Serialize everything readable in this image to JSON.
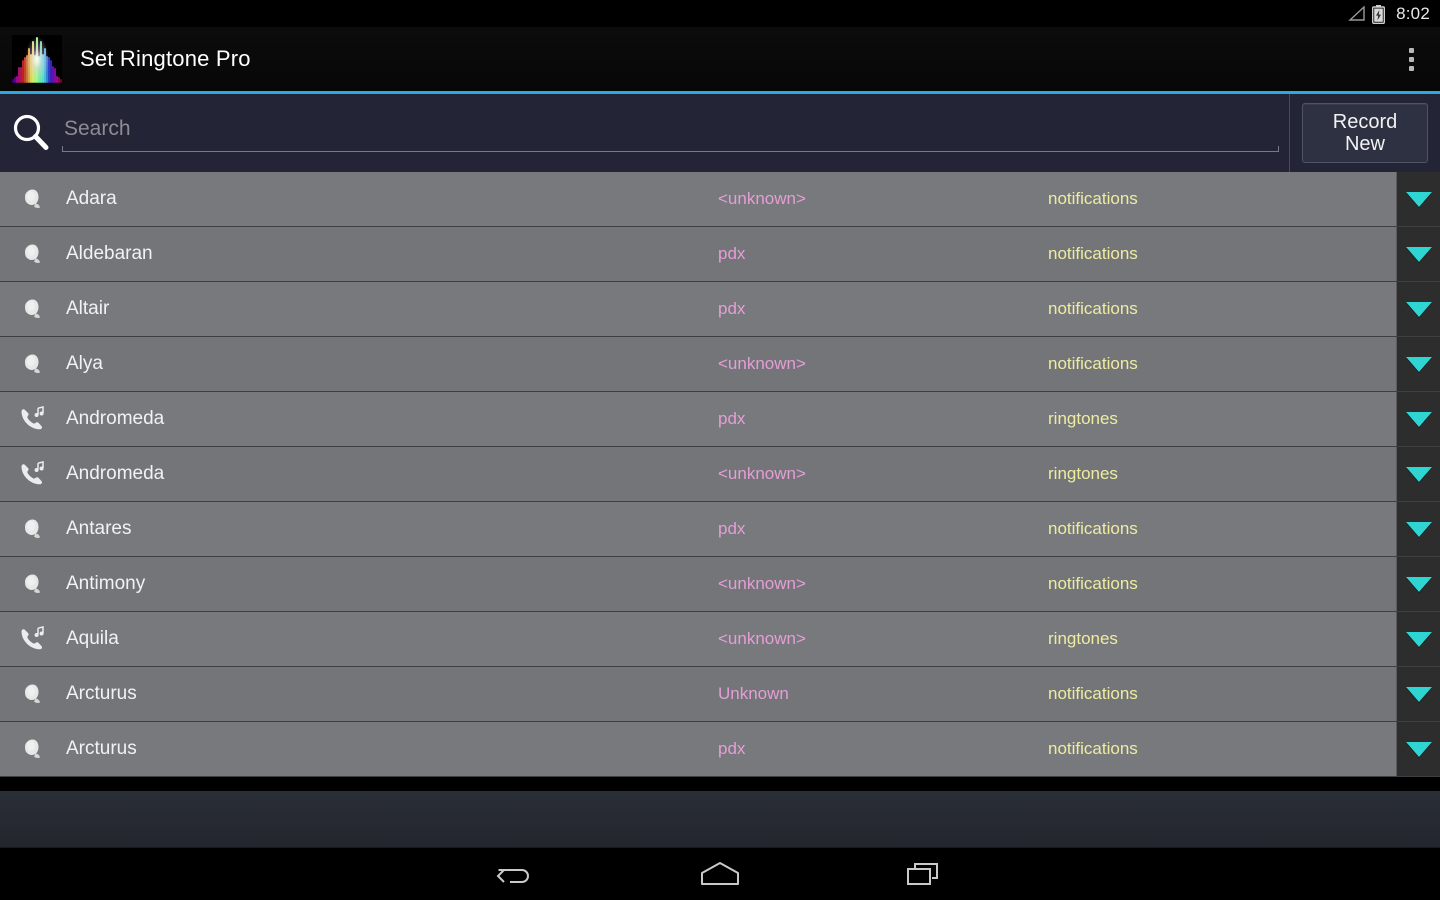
{
  "statusbar": {
    "time": "8:02",
    "icons": [
      "signal-icon",
      "battery-charging-icon"
    ]
  },
  "titlebar": {
    "app_name": "Set Ringtone Pro",
    "app_icon": "waveform-icon",
    "overflow_menu": "overflow-menu-icon"
  },
  "search": {
    "icon": "search-icon",
    "placeholder": "Search",
    "value": "",
    "record_button": "Record\nNew",
    "record_button_line1": "Record",
    "record_button_line2": "New"
  },
  "colors": {
    "accent_line": "#2ca9e0",
    "search_bg": "#242437",
    "list_row": "#77797d",
    "artist_text": "#e59ed6",
    "type_text": "#efeca0",
    "caret": "#2fd5d2",
    "dropdown_col": "#2d2d2d"
  },
  "list": {
    "columns": [
      "name",
      "artist",
      "type"
    ],
    "rows": [
      {
        "icon": "notification-bell-icon",
        "name": "Adara",
        "artist": "<unknown>",
        "type": "notifications",
        "dropdown": "expand-arrow-icon"
      },
      {
        "icon": "notification-bell-icon",
        "name": "Aldebaran",
        "artist": "pdx",
        "type": "notifications",
        "dropdown": "expand-arrow-icon"
      },
      {
        "icon": "notification-bell-icon",
        "name": "Altair",
        "artist": "pdx",
        "type": "notifications",
        "dropdown": "expand-arrow-icon"
      },
      {
        "icon": "notification-bell-icon",
        "name": "Alya",
        "artist": "<unknown>",
        "type": "notifications",
        "dropdown": "expand-arrow-icon"
      },
      {
        "icon": "ringtone-phone-icon",
        "name": "Andromeda",
        "artist": "pdx",
        "type": "ringtones",
        "dropdown": "expand-arrow-icon"
      },
      {
        "icon": "ringtone-phone-icon",
        "name": "Andromeda",
        "artist": "<unknown>",
        "type": "ringtones",
        "dropdown": "expand-arrow-icon"
      },
      {
        "icon": "notification-bell-icon",
        "name": "Antares",
        "artist": "pdx",
        "type": "notifications",
        "dropdown": "expand-arrow-icon"
      },
      {
        "icon": "notification-bell-icon",
        "name": "Antimony",
        "artist": "<unknown>",
        "type": "notifications",
        "dropdown": "expand-arrow-icon"
      },
      {
        "icon": "ringtone-phone-icon",
        "name": "Aquila",
        "artist": "<unknown>",
        "type": "ringtones",
        "dropdown": "expand-arrow-icon"
      },
      {
        "icon": "notification-bell-icon",
        "name": "Arcturus",
        "artist": "Unknown",
        "type": "notifications",
        "dropdown": "expand-arrow-icon"
      },
      {
        "icon": "notification-bell-icon",
        "name": "Arcturus",
        "artist": "pdx",
        "type": "notifications",
        "dropdown": "expand-arrow-icon"
      }
    ]
  },
  "navbar": {
    "back": "back-icon",
    "home": "home-icon",
    "recents": "recents-icon"
  }
}
